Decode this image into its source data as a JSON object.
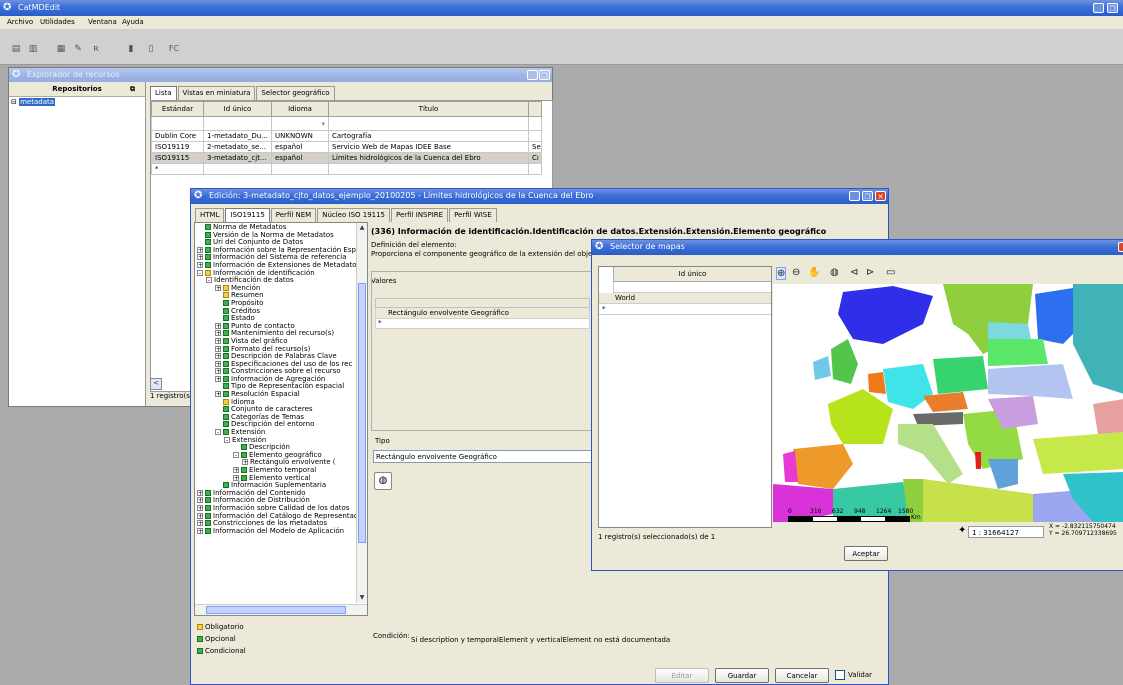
{
  "app": {
    "title": "CatMDEdit",
    "menu": [
      "Archivo",
      "Utilidades",
      "Ventana",
      "Ayuda"
    ],
    "toolbar_fc": "FC"
  },
  "explorer": {
    "title": "Explorador de recursos",
    "repos_header": "Repositorios",
    "repo_item": "metadata",
    "tabs": [
      "Lista",
      "Vistas en miniatura",
      "Selector geográfico"
    ],
    "columns": [
      "Estándar",
      "Id único",
      "Idioma",
      "Título"
    ],
    "rows": [
      [
        "Dublin Core",
        "1-metadato_Du...",
        "UNKNOWN",
        "Cartografía",
        ""
      ],
      [
        "ISO19119",
        "2-metadato_se...",
        "español",
        "Servicio Web de Mapas IDEE Base",
        "Se"
      ],
      [
        "ISO19115",
        "3-metadato_cjt...",
        "español",
        "Límites hidrológicos de la Cuenca del Ebro",
        "Cı"
      ]
    ],
    "status": "1 registro(s"
  },
  "edit": {
    "title": "Edición: 3-metadato_cjto_datos_ejemplo_20100205 - Límites hidrológicos de la Cuenca del Ebro",
    "tabs": [
      "HTML",
      "ISO19115",
      "Perfil NEM",
      "Núcleo ISO 19115",
      "Perfil INSPIRE",
      "Perfil WISE"
    ],
    "tree": [
      {
        "t": "Norma de Metadatos",
        "d": 1,
        "c": "g",
        "pm": ""
      },
      {
        "t": "Versión de la Norma de Metadatos",
        "d": 1,
        "c": "g",
        "pm": ""
      },
      {
        "t": "Uri del Conjunto de Datos",
        "d": 1,
        "c": "g",
        "pm": ""
      },
      {
        "t": "Información sobre la Representación Espa",
        "d": 1,
        "c": "g",
        "pm": "+"
      },
      {
        "t": "Información del Sistema de referencia",
        "d": 1,
        "c": "g",
        "pm": "+"
      },
      {
        "t": "Información de Extensiones de Metadatos",
        "d": 1,
        "c": "g",
        "pm": "+"
      },
      {
        "t": "Información de identificación",
        "d": 1,
        "c": "y",
        "pm": "-"
      },
      {
        "t": "Identificación de datos",
        "d": 2,
        "c": "",
        "pm": "-"
      },
      {
        "t": "Mención",
        "d": 3,
        "c": "y",
        "pm": "+"
      },
      {
        "t": "Resumen",
        "d": 3,
        "c": "y",
        "pm": ""
      },
      {
        "t": "Propósito",
        "d": 3,
        "c": "g",
        "pm": ""
      },
      {
        "t": "Créditos",
        "d": 3,
        "c": "g",
        "pm": ""
      },
      {
        "t": "Estado",
        "d": 3,
        "c": "g",
        "pm": ""
      },
      {
        "t": "Punto de contacto",
        "d": 3,
        "c": "g",
        "pm": "+"
      },
      {
        "t": "Mantenimiento del recurso(s)",
        "d": 3,
        "c": "g",
        "pm": "+"
      },
      {
        "t": "Vista del gráfico",
        "d": 3,
        "c": "g",
        "pm": "+"
      },
      {
        "t": "Formato del recurso(s)",
        "d": 3,
        "c": "g",
        "pm": "+"
      },
      {
        "t": "Descripción de Palabras Clave",
        "d": 3,
        "c": "g",
        "pm": "+"
      },
      {
        "t": "Especificaciones del uso de los rec",
        "d": 3,
        "c": "g",
        "pm": "+"
      },
      {
        "t": "Constricciones sobre el recurso",
        "d": 3,
        "c": "g",
        "pm": "+"
      },
      {
        "t": "Información de Agregación",
        "d": 3,
        "c": "g",
        "pm": "+"
      },
      {
        "t": "Tipo de  Representación espacial",
        "d": 3,
        "c": "g",
        "pm": ""
      },
      {
        "t": "Resolución Espacial",
        "d": 3,
        "c": "g",
        "pm": "+"
      },
      {
        "t": "Idioma",
        "d": 3,
        "c": "y",
        "pm": ""
      },
      {
        "t": "Conjunto de caracteres",
        "d": 3,
        "c": "g",
        "pm": ""
      },
      {
        "t": "Categorías de Temas",
        "d": 3,
        "c": "g",
        "pm": ""
      },
      {
        "t": "Descripción del entorno",
        "d": 3,
        "c": "g",
        "pm": ""
      },
      {
        "t": "Extensión",
        "d": 3,
        "c": "g",
        "pm": "-"
      },
      {
        "t": "Extensión",
        "d": 4,
        "c": "",
        "pm": "-"
      },
      {
        "t": "Descripción",
        "d": 5,
        "c": "g",
        "pm": ""
      },
      {
        "t": "Elemento geográfico",
        "d": 5,
        "c": "g",
        "pm": "-"
      },
      {
        "t": "Rectángulo envolvente (",
        "d": 6,
        "c": "",
        "pm": "+"
      },
      {
        "t": "Elemento temporal",
        "d": 5,
        "c": "g",
        "pm": "+"
      },
      {
        "t": "Elemento vertical",
        "d": 5,
        "c": "g",
        "pm": "+"
      },
      {
        "t": "Información Suplementaria",
        "d": 3,
        "c": "g",
        "pm": ""
      },
      {
        "t": "Información del Contenido",
        "d": 1,
        "c": "g",
        "pm": "+"
      },
      {
        "t": "Información de Distribución",
        "d": 1,
        "c": "g",
        "pm": "+"
      },
      {
        "t": "Información sobre Calidad de los datos",
        "d": 1,
        "c": "g",
        "pm": "+"
      },
      {
        "t": "Información del Catálogo de Representacı",
        "d": 1,
        "c": "g",
        "pm": "+"
      },
      {
        "t": "Constricciones de los metadatos",
        "d": 1,
        "c": "g",
        "pm": "+"
      },
      {
        "t": "Información del Modelo de Aplicación",
        "d": 1,
        "c": "g",
        "pm": "+"
      }
    ],
    "legend": [
      "Obligatorio",
      "Opcional",
      "Condicional"
    ],
    "heading": "(336) Información de identificación.Identificación de datos.Extensión.Extensión.Elemento geográfico",
    "def_label": "Definición del elemento:",
    "def_text": "Proporciona el componente geográfico de la extensión del objeto co",
    "valores_label": "Valores",
    "valores_cell": "Rectángulo envolvente Geográfico",
    "tipo_label": "Tipo",
    "tipo_value": "Rectángulo envolvente Geográfico",
    "cond_label": "Condición:",
    "cond_text": "Si description y temporalElement y verticalElement no está documentada",
    "buttons": {
      "editar": "Editar",
      "guardar": "Guardar",
      "cancelar": "Cancelar",
      "validar": "Validar"
    }
  },
  "selector": {
    "title": "Selector de mapas",
    "col": "Id único",
    "row": "World",
    "status": "1 registro(s) seleccionado(s) de 1",
    "scale": "1 : 31664127",
    "coord_x": "X = -2.832115750474",
    "coord_y": "Y = 26.709712338695",
    "scale_ticks": [
      "0",
      "316",
      "632",
      "948",
      "1264",
      "1580"
    ],
    "scale_unit": "Km",
    "ok": "Aceptar"
  }
}
